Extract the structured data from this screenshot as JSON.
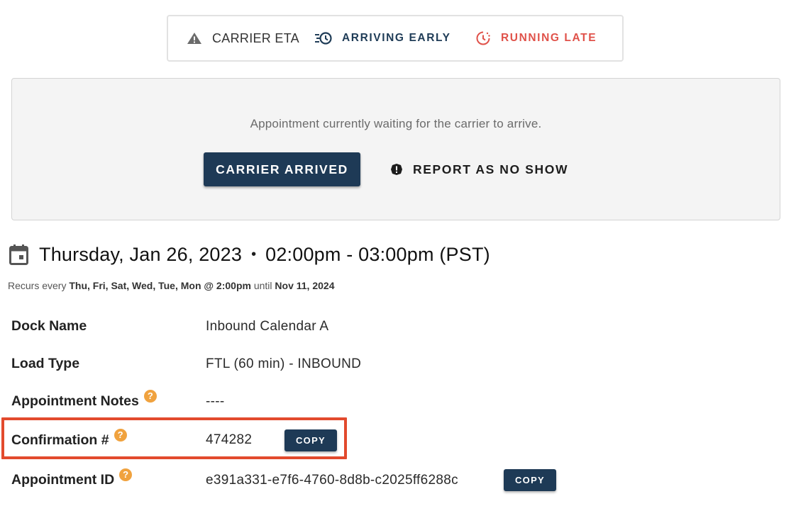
{
  "eta": {
    "carrier_eta_label": "CARRIER ETA",
    "arriving_early_label": "ARRIVING EARLY",
    "running_late_label": "RUNNING LATE",
    "early_color": "#1f3c57",
    "late_color": "#e0524a"
  },
  "panel": {
    "message": "Appointment currently waiting for the carrier to arrive.",
    "carrier_arrived_label": "CARRIER ARRIVED",
    "report_no_show_label": "REPORT AS NO SHOW",
    "primary_color": "#1e3a56"
  },
  "schedule": {
    "date": "Thursday, Jan 26, 2023",
    "separator": "•",
    "time_range": "02:00pm - 03:00pm (PST)",
    "recurs_prefix": "Recurs every",
    "recurs_days": "Thu, Fri, Sat, Wed, Tue, Mon @ 2:00pm",
    "recurs_until_word": "until",
    "recurs_until_date": "Nov 11, 2024"
  },
  "details": {
    "dock_name_label": "Dock Name",
    "dock_name_value": "Inbound Calendar A",
    "load_type_label": "Load Type",
    "load_type_value": "FTL (60 min) - INBOUND",
    "notes_label": "Appointment Notes",
    "notes_value": "----",
    "confirmation_label": "Confirmation #",
    "confirmation_value": "474282",
    "appointment_id_label": "Appointment ID",
    "appointment_id_value": "e391a331-e7f6-4760-8d8b-c2025ff6288c",
    "copy_label": "COPY",
    "help_glyph": "?",
    "help_color": "#f0a23e",
    "highlight_color": "#e24a2d"
  }
}
